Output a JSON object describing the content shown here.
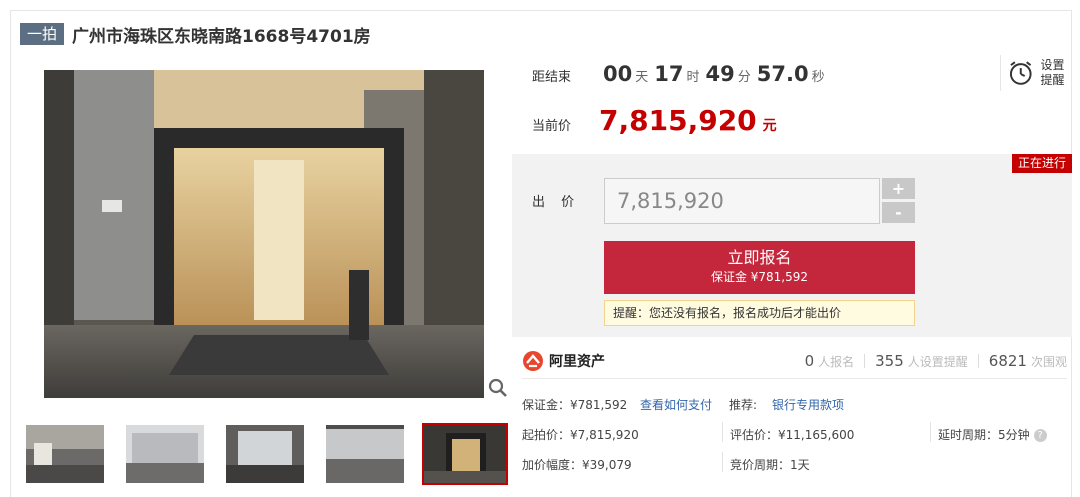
{
  "title": {
    "badge": "一拍",
    "text": "广州市海珠区东晓南路1668号4701房"
  },
  "countdown": {
    "label": "距结束",
    "days": "00",
    "days_unit": "天",
    "hours": "17",
    "hours_unit": "时",
    "minutes": "49",
    "minutes_unit": "分",
    "seconds": "57.0",
    "seconds_unit": "秒"
  },
  "reminder": {
    "label": "设置提醒",
    "icon": "alarm-clock-icon"
  },
  "current_price": {
    "label": "当前价",
    "value": "7,815,920",
    "unit": "元"
  },
  "status_badge": "正在进行",
  "bid": {
    "label": "出 价",
    "value": "7,815,920",
    "plus": "+",
    "minus": "-"
  },
  "signup_button": {
    "label": "立即报名",
    "deposit": "保证金 ¥781,592"
  },
  "tip": "提醒：您还没有报名，报名成功后才能出价",
  "platform": {
    "name": "阿里资产",
    "icon": "ali-asset-logo-icon"
  },
  "stats": [
    {
      "value": "0",
      "label": "人报名"
    },
    {
      "value": "355",
      "label": "人设置提醒"
    },
    {
      "value": "6821",
      "label": "次围观"
    }
  ],
  "info": {
    "deposit": "保证金：¥781,592",
    "how_to_pay": "查看如何支付",
    "recommend_label": "推荐:",
    "recommend_link": "银行专用款项",
    "start_price": "起拍价：¥7,815,920",
    "appraisal": "评估价：¥11,165,600",
    "delay": "延时周期：5分钟",
    "increment": "加价幅度：¥39,079",
    "auction_period": "竞价周期：1天"
  },
  "colors": {
    "accent_red": "#c40000",
    "button_red": "#c4273b",
    "badge_gray": "#5b6e82",
    "link_blue": "#3366aa"
  }
}
